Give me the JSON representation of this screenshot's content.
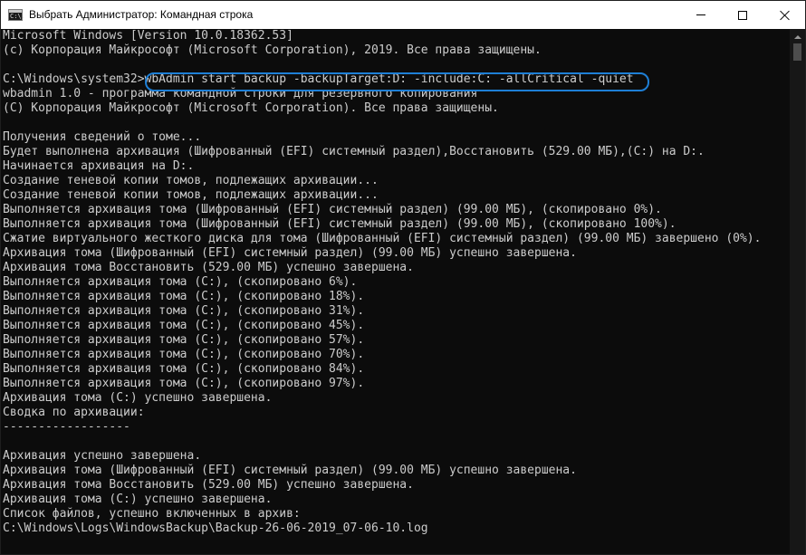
{
  "window": {
    "title": "Выбрать Администратор: Командная строка",
    "app_icon_text": "C:\\."
  },
  "controls": {
    "minimize": "minimize",
    "maximize": "maximize",
    "close": "close"
  },
  "colors": {
    "console_bg": "#0c0c0c",
    "console_text": "#cccccc",
    "highlight": "#1e7fd6"
  },
  "console": {
    "lines": [
      "Microsoft Windows [Version 10.0.18362.53]",
      "(c) Корпорация Майкрософт (Microsoft Corporation), 2019. Все права защищены.",
      "",
      "C:\\Windows\\system32>wbAdmin start backup -backupTarget:D: -include:C: -allCritical -quiet",
      "wbadmin 1.0 - программа командной строки для резервного копирования",
      "(C) Корпорация Майкрософт (Microsoft Corporation). Все права защищены.",
      "",
      "Получения сведений о томе...",
      "Будет выполнена архивация (Шифрованный (EFI) системный раздел),Восстановить (529.00 МБ),(C:) на D:.",
      "Начинается архивация на D:.",
      "Создание теневой копии томов, подлежащих архивации...",
      "Создание теневой копии томов, подлежащих архивации...",
      "Выполняется архивация тома (Шифрованный (EFI) системный раздел) (99.00 МБ), (скопировано 0%).",
      "Выполняется архивация тома (Шифрованный (EFI) системный раздел) (99.00 МБ), (скопировано 100%).",
      "Сжатие виртуального жесткого диска для тома (Шифрованный (EFI) системный раздел) (99.00 МБ) завершено (0%).",
      "Архивация тома (Шифрованный (EFI) системный раздел) (99.00 МБ) успешно завершена.",
      "Архивация тома Восстановить (529.00 МБ) успешно завершена.",
      "Выполняется архивация тома (C:), (скопировано 6%).",
      "Выполняется архивация тома (C:), (скопировано 18%).",
      "Выполняется архивация тома (C:), (скопировано 31%).",
      "Выполняется архивация тома (C:), (скопировано 45%).",
      "Выполняется архивация тома (C:), (скопировано 57%).",
      "Выполняется архивация тома (C:), (скопировано 70%).",
      "Выполняется архивация тома (C:), (скопировано 84%).",
      "Выполняется архивация тома (C:), (скопировано 97%).",
      "Архивация тома (C:) успешно завершена.",
      "Сводка по архивации:",
      "------------------",
      "",
      "Архивация успешно завершена.",
      "Архивация тома (Шифрованный (EFI) системный раздел) (99.00 МБ) успешно завершена.",
      "Архивация тома Восстановить (529.00 МБ) успешно завершена.",
      "Архивация тома (C:) успешно завершена.",
      "Список файлов, успешно включенных в архив:",
      "C:\\Windows\\Logs\\WindowsBackup\\Backup-26-06-2019_07-06-10.log"
    ]
  }
}
